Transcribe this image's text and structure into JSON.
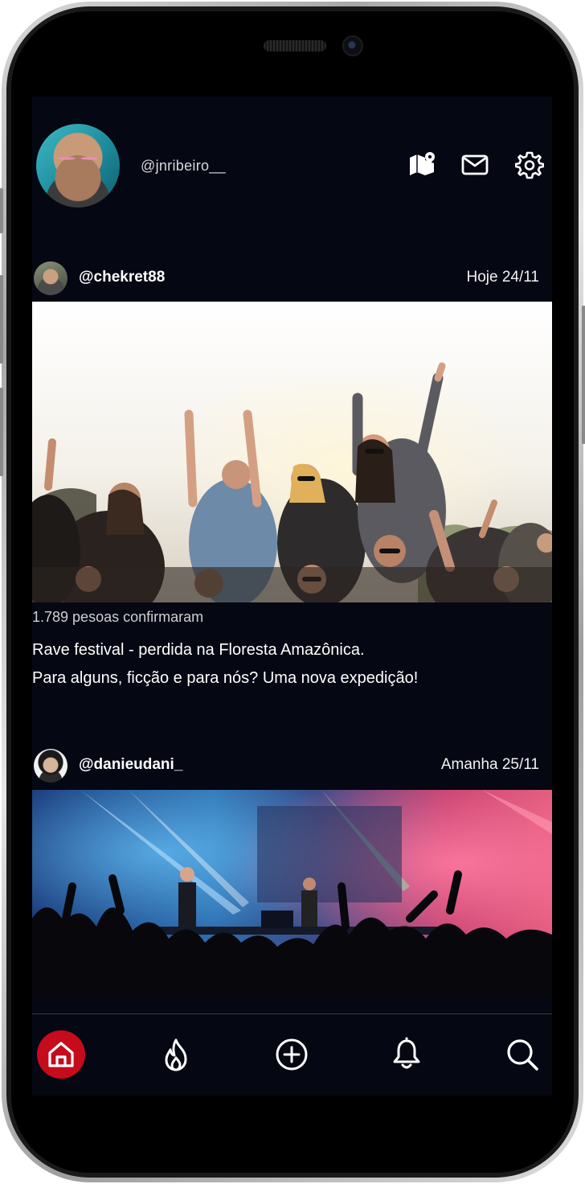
{
  "header": {
    "username": "@jnribeiro__",
    "icons": [
      "map-pin-icon",
      "mail-icon",
      "gear-icon"
    ]
  },
  "posts": [
    {
      "user": "@chekret88",
      "date": "Hoje 24/11",
      "confirmed": "1.789 pesoas confirmaram",
      "caption_lines": [
        "Rave  festival - perdida na Floresta Amazônica.",
        "Para alguns, ficção e para nós? Uma nova expedição!"
      ]
    },
    {
      "user": "@danieudani_",
      "date": "Amanha 25/11"
    }
  ],
  "nav": {
    "items": [
      "home-icon",
      "flame-icon",
      "plus-circle-icon",
      "bell-icon",
      "search-icon"
    ],
    "active": "home-icon",
    "accent": "#c50b1c"
  },
  "colors": {
    "background": "#050713",
    "text": "#ffffff"
  }
}
